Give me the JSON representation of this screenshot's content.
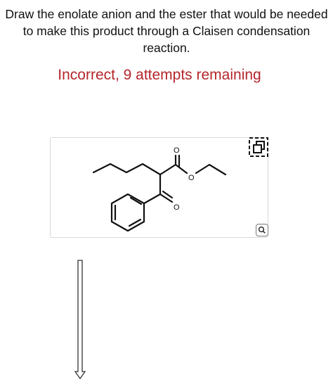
{
  "question": {
    "lines": [
      "Draw the enolate anion and the ester that would be needed",
      "to make this product through a Claisen condensation",
      "reaction."
    ]
  },
  "feedback": {
    "text": "Incorrect, 9 attempts remaining",
    "color": "#b5252b"
  },
  "molecule": {
    "atom_labels": {
      "carbonyl_o_ester": "O",
      "ester_o": "O",
      "ketone_o": "O"
    }
  },
  "controls": {
    "expand_icon": "expand-icon",
    "zoom_icon": "zoom-icon"
  },
  "arrow": {
    "direction": "down"
  }
}
